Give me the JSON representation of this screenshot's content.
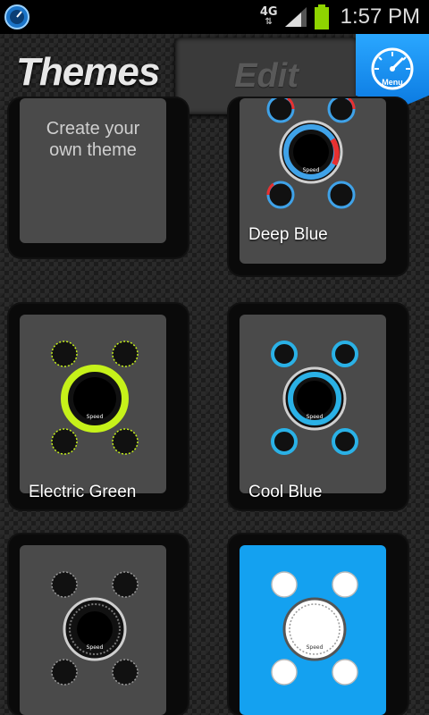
{
  "status_bar": {
    "network_type": "4G",
    "network_arrows": "⇅",
    "time": "1:57 PM",
    "battery_color": "#8fd400"
  },
  "header": {
    "themes_tab": "Themes",
    "edit_tab": "Edit",
    "menu_label": "Menu"
  },
  "themes": [
    {
      "label": "",
      "create_text_line1": "Create your",
      "create_text_line2": "own theme"
    },
    {
      "label": "Deep Blue",
      "accent": "#3fa2e8",
      "highlight": "#e83030"
    },
    {
      "label": "Electric Green",
      "accent": "#c6f21a"
    },
    {
      "label": "Cool Blue",
      "accent": "#2ab1e6"
    },
    {
      "label": "",
      "accent": "#9a9a9a"
    },
    {
      "label": "",
      "accent": "#ffffff",
      "selected": true
    }
  ],
  "gauge_labels": {
    "speed": "Speed"
  },
  "colors": {
    "selected_card": "#14a1f0",
    "menu_button": "#1a8ff0"
  }
}
